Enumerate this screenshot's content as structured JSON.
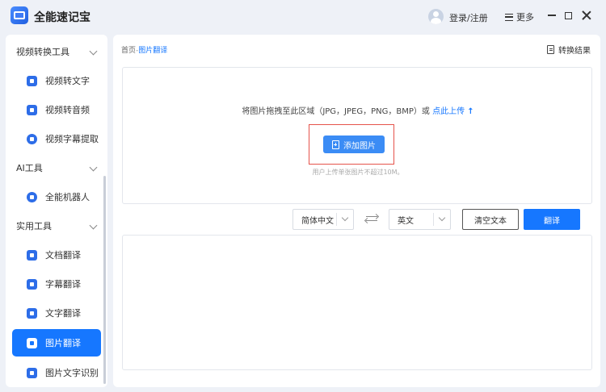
{
  "app": {
    "title": "全能速记宝"
  },
  "header": {
    "login_label": "登录/注册",
    "more_label": "更多"
  },
  "sidebar": {
    "groups": [
      {
        "label": "视频转换工具"
      },
      {
        "label": "AI工具"
      },
      {
        "label": "实用工具"
      }
    ],
    "items": [
      {
        "label": "视频转文字",
        "icon": "text-icon"
      },
      {
        "label": "视频转音频",
        "icon": "music-icon"
      },
      {
        "label": "视频字幕提取",
        "icon": "subtitle-icon"
      },
      {
        "label": "全能机器人",
        "icon": "robot-icon"
      },
      {
        "label": "文档翻译",
        "icon": "document-icon"
      },
      {
        "label": "字幕翻译",
        "icon": "subtitle-icon"
      },
      {
        "label": "文字翻译",
        "icon": "text-icon"
      },
      {
        "label": "图片翻译",
        "icon": "image-icon",
        "active": true
      },
      {
        "label": "图片文字识别",
        "icon": "ocr-icon"
      }
    ]
  },
  "main": {
    "breadcrumb": {
      "home": "首页",
      "separator": "-",
      "current": "图片翻译"
    },
    "result_label": "转换结果",
    "dropzone": {
      "hint": "将图片拖拽至此区域（JPG，JPEG，PNG，BMP）或",
      "upload_link": "点此上传",
      "add_button": "添加图片",
      "size_note": "用户上传单张图片不超过10M。"
    },
    "source_lang": "简体中文",
    "target_lang": "英文",
    "clear_button": "清空文本",
    "translate_button": "翻译"
  },
  "colors": {
    "accent": "#1677ff",
    "highlight": "#e5534b"
  }
}
